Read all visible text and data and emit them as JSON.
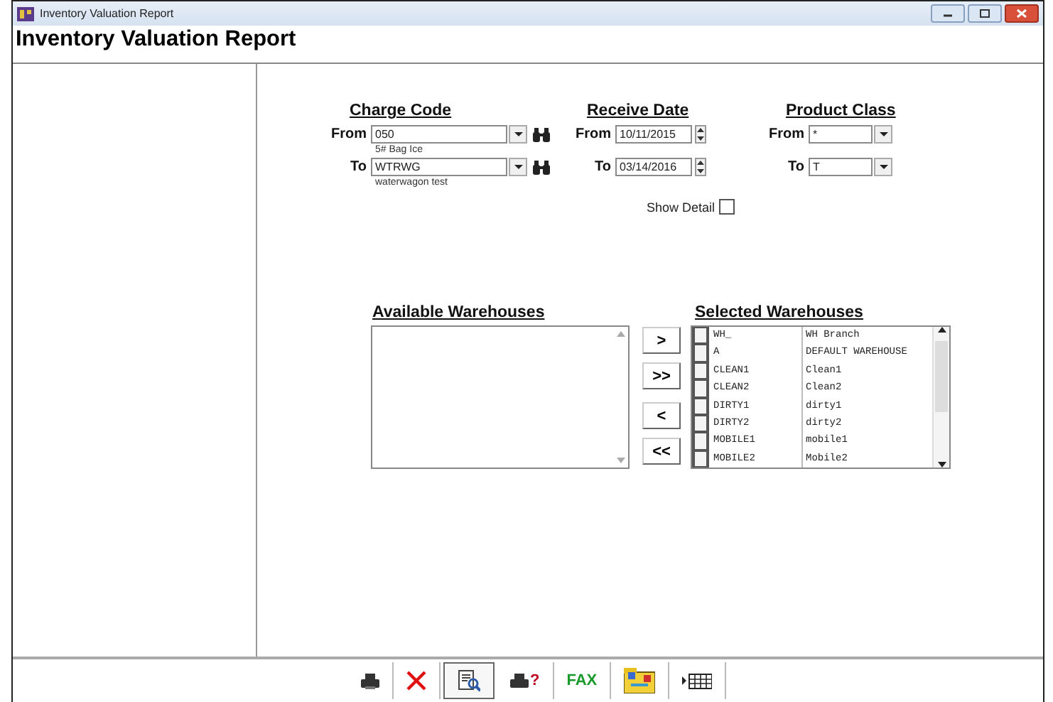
{
  "window": {
    "title": "Inventory Valuation Report"
  },
  "header": {
    "title": "Inventory Valuation Report"
  },
  "charge_code": {
    "heading": "Charge Code",
    "rows": [
      {
        "label": "From",
        "value": "050",
        "note": "5# Bag Ice"
      },
      {
        "label": "To",
        "value": "WTRWG",
        "note": "waterwagon test"
      }
    ]
  },
  "receive_date": {
    "heading": "Receive Date",
    "rows": [
      {
        "label": "From",
        "value": "10/11/2015"
      },
      {
        "label": "To",
        "value": "03/14/2016"
      }
    ]
  },
  "product_class": {
    "heading": "Product Class",
    "rows": [
      {
        "label": "From",
        "value": "*"
      },
      {
        "label": "To",
        "value": "T"
      }
    ]
  },
  "show_detail": {
    "label": "Show Detail",
    "checked": false
  },
  "available_warehouses": {
    "heading": "Available Warehouses"
  },
  "transfer_buttons": [
    ">",
    ">>",
    "<",
    "<<"
  ],
  "selected_warehouses": {
    "heading": "Selected Warehouses",
    "rows": [
      {
        "code": "WH_",
        "description": "WH Branch",
        "checked": false
      },
      {
        "code": "A",
        "description": "DEFAULT WAREHOUSE",
        "checked": false
      },
      {
        "code": "CLEAN1",
        "description": "Clean1",
        "checked": false
      },
      {
        "code": "CLEAN2",
        "description": "Clean2",
        "checked": false
      },
      {
        "code": "DIRTY1",
        "description": "dirty1",
        "checked": false
      },
      {
        "code": "DIRTY2",
        "description": "dirty2",
        "checked": false
      },
      {
        "code": "MOBILE1",
        "description": "mobile1",
        "checked": false
      },
      {
        "code": "MOBILE2",
        "description": "Mobile2",
        "checked": false
      }
    ]
  },
  "toolbar": [
    {
      "kind": "print",
      "selected": false
    },
    {
      "kind": "cancel",
      "selected": false
    },
    {
      "kind": "preview",
      "selected": true
    },
    {
      "kind": "print_query",
      "text": "?",
      "selected": false
    },
    {
      "kind": "fax",
      "text": "FAX",
      "selected": false
    },
    {
      "kind": "folder",
      "selected": false
    },
    {
      "kind": "grid",
      "selected": false
    }
  ]
}
